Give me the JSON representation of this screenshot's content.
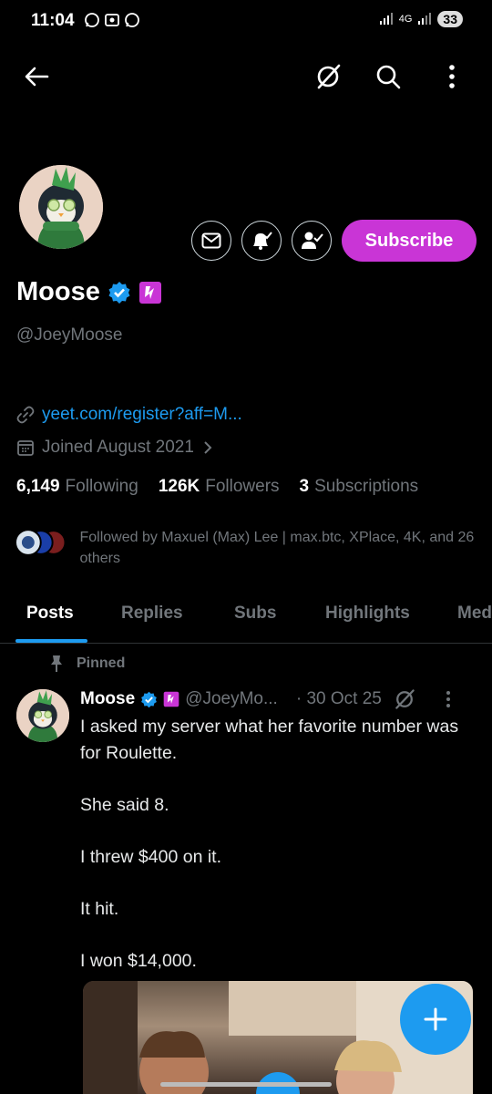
{
  "status_bar": {
    "time": "11:04",
    "network": "4G",
    "battery": "33"
  },
  "profile": {
    "name": "Moose",
    "handle": "@JoeyMoose",
    "subscribe_label": "Subscribe",
    "link": "yeet.com/register?aff=M...",
    "joined": "Joined August 2021",
    "following_count": "6,149",
    "following_label": "Following",
    "followers_count": "126K",
    "followers_label": "Followers",
    "subscriptions_count": "3",
    "subscriptions_label": "Subscriptions",
    "followed_by": "Followed by Maxuel (Max) Lee | max.btc, XPlace, 4K, and 26 others"
  },
  "tabs": [
    {
      "label": "Posts",
      "active": true
    },
    {
      "label": "Replies",
      "active": false
    },
    {
      "label": "Subs",
      "active": false
    },
    {
      "label": "Highlights",
      "active": false
    },
    {
      "label": "Med",
      "active": false
    }
  ],
  "post": {
    "pinned_label": "Pinned",
    "author": "Moose",
    "handle": "@JoeyMo...",
    "date": "· 30 Oct 25",
    "text": "I asked my server what her favorite number was for Roulette.\n\nShe said 8.\n\nI threw $400 on it.\n\nIt hit.\n\nI won $14,000."
  },
  "colors": {
    "accent": "#1d9bf0",
    "subscribe": "#c935d6",
    "verified": "#1d9bf0",
    "badge": "#c935d6"
  },
  "icons": [
    "back-arrow-icon",
    "grok-icon",
    "search-icon",
    "more-vertical-icon",
    "mail-icon",
    "bell-icon",
    "person-check-icon",
    "verified-icon",
    "link-icon",
    "calendar-icon",
    "chevron-right-icon",
    "pin-icon",
    "plus-icon"
  ]
}
